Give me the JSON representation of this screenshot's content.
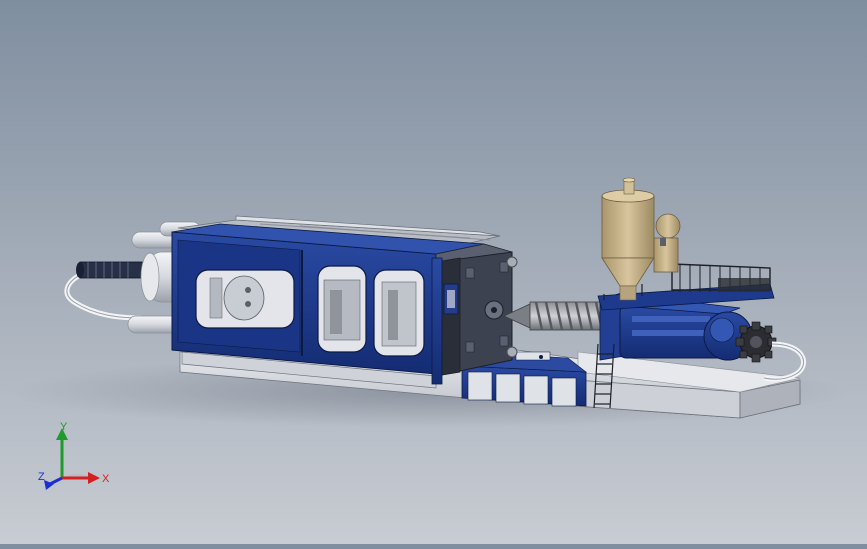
{
  "triad": {
    "x_label": "X",
    "y_label": "Y",
    "z_label": "Z"
  },
  "colors": {
    "machine_blue": "#1b3a8c",
    "machine_blue_dark": "#0f2461",
    "steel_light": "#d9dbe0",
    "steel_mid": "#a9adb6",
    "steel_dark": "#4a4e57",
    "hopper_tan": "#c9b58d",
    "axis_x": "#d42020",
    "axis_y": "#1f9a2c",
    "axis_z": "#1d2fd0"
  }
}
